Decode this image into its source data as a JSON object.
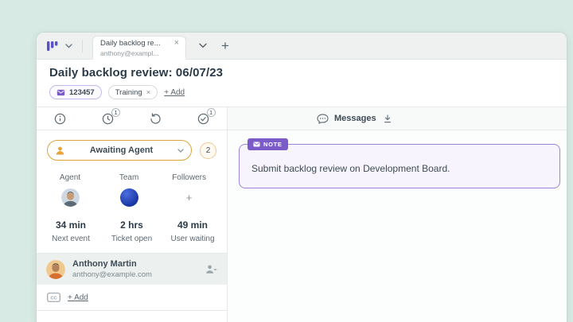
{
  "tab_bar": {
    "tab_title": "Daily backlog re...",
    "tab_close": "×",
    "tab_subtitle": "anthony@exampl...",
    "new_tab_label": "+"
  },
  "header": {
    "title": "Daily backlog review: 06/07/23",
    "ticket_number": "123457",
    "tag_label": "Training",
    "tag_close": "×",
    "add_tag_label": "+ Add"
  },
  "sidebar": {
    "clock_badge": "1",
    "check_badge": "1",
    "status": {
      "label": "Awaiting Agent",
      "count": "2"
    },
    "people": {
      "agent_label": "Agent",
      "team_label": "Team",
      "followers_label": "Followers",
      "add_follower_label": "+"
    },
    "stats": [
      {
        "value": "34 min",
        "label": "Next event"
      },
      {
        "value": "2 hrs",
        "label": "Ticket open"
      },
      {
        "value": "49 min",
        "label": "User waiting"
      }
    ],
    "contact": {
      "name": "Anthony Martin",
      "email": "anthony@example.com"
    },
    "cc": {
      "icon_label": "CC",
      "add_label": "+ Add"
    }
  },
  "messages": {
    "title": "Messages",
    "note": {
      "badge_label": "NOTE",
      "text": "Submit backlog review on Development Board."
    }
  },
  "colors": {
    "accent_purple": "#7a5bc7",
    "accent_orange": "#dfa33f",
    "background_mint": "#d8eae4"
  }
}
